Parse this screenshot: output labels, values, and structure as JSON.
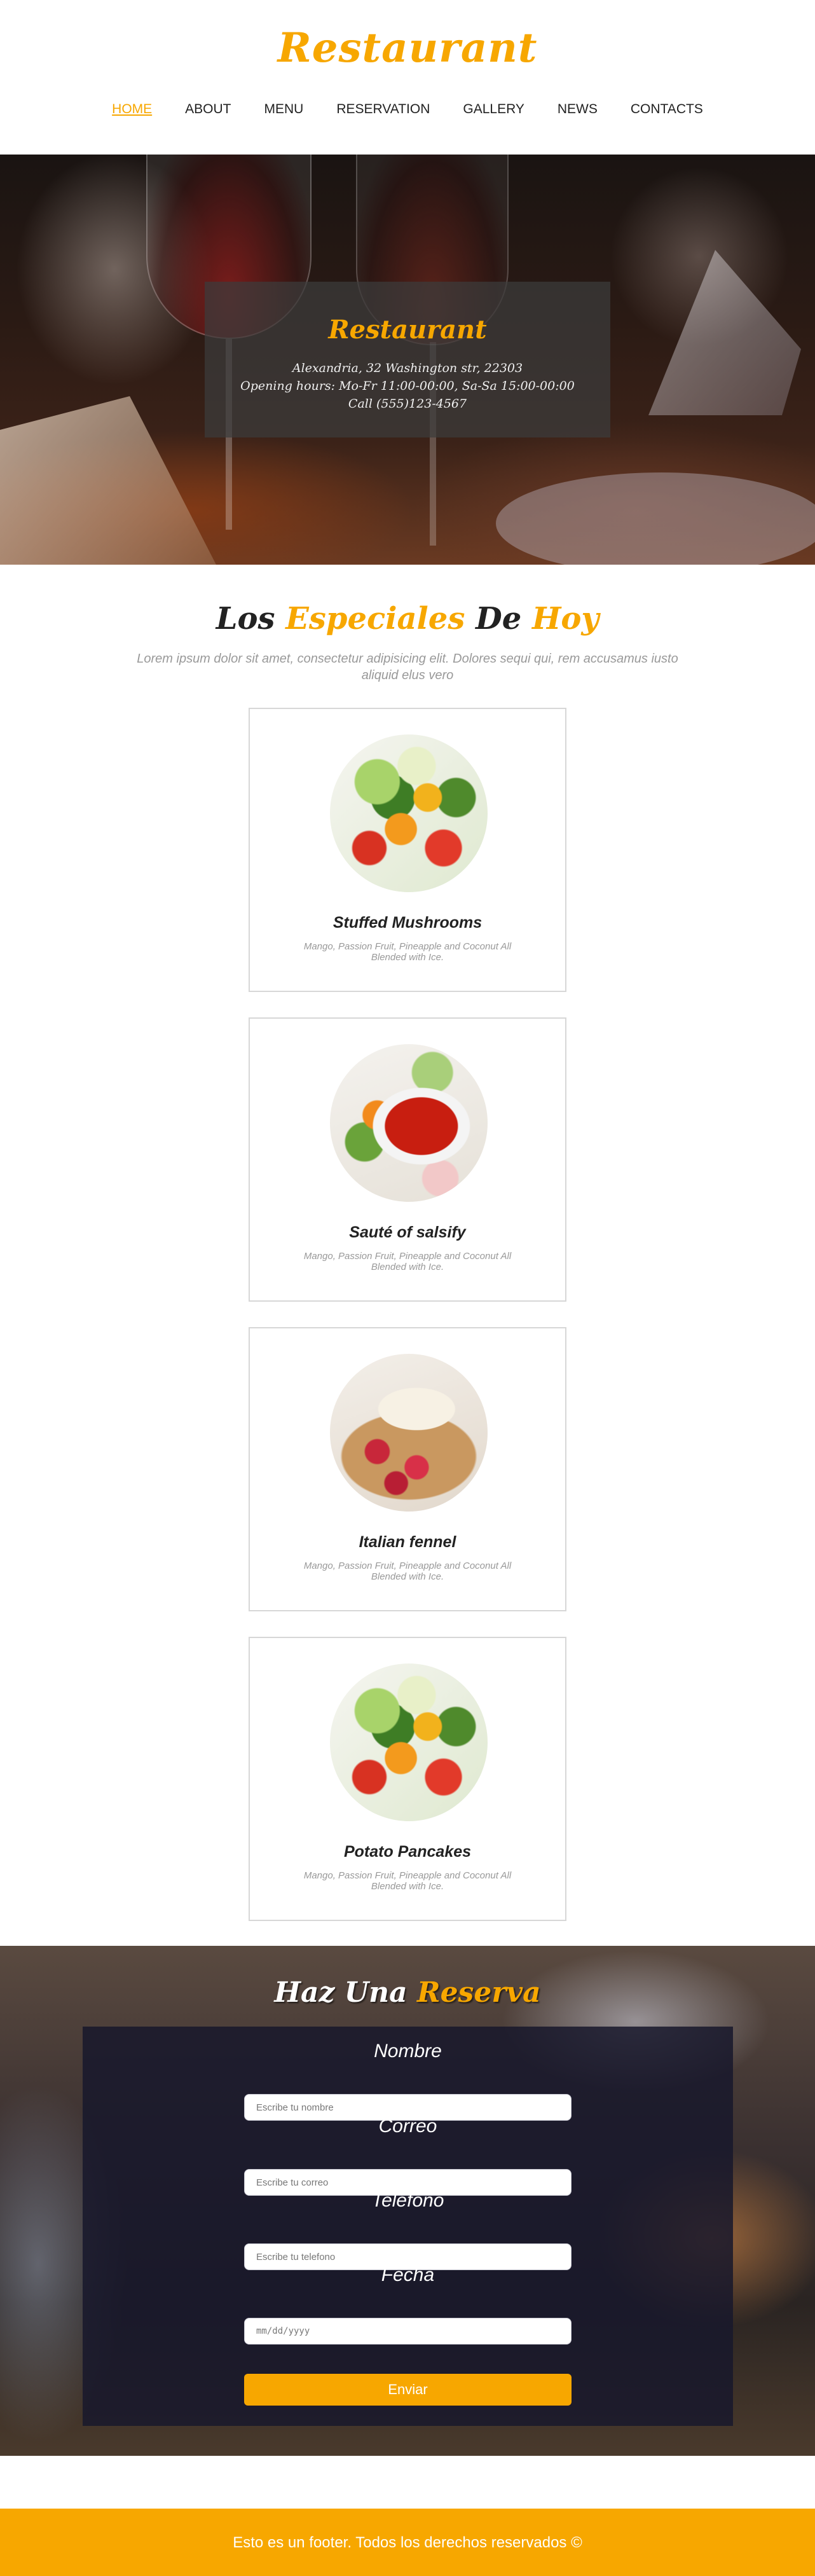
{
  "site": {
    "logo": "Restaurant"
  },
  "nav": {
    "items": [
      {
        "label": "HOME",
        "active": true
      },
      {
        "label": "ABOUT"
      },
      {
        "label": "MENU"
      },
      {
        "label": "RESERVATION"
      },
      {
        "label": "GALLERY"
      },
      {
        "label": "NEWS"
      },
      {
        "label": "CONTACTS"
      }
    ]
  },
  "hero": {
    "title": "Restaurant",
    "address": "Alexandria, 32 Washington str, 22303",
    "hours": "Opening hours: Mo-Fr 11:00-00:00, Sa-Sa 15:00-00:00",
    "phone": "Call (555)123-4567"
  },
  "specials": {
    "title_part1": "Los",
    "title_part2": "Especiales",
    "title_part3": "De",
    "title_part4": "Hoy",
    "subtitle": "Lorem ipsum dolor sit amet, consectetur adipisicing elit. Dolores sequi qui, rem accusamus iusto aliquid elus vero",
    "items": [
      {
        "name": "Stuffed Mushrooms",
        "description": "Mango, Passion Fruit, Pineapple and Coconut All Blended with Ice.",
        "image": "salad"
      },
      {
        "name": "Sauté of salsify",
        "description": "Mango, Passion Fruit, Pineapple and Coconut All Blended with Ice.",
        "image": "salsa"
      },
      {
        "name": "Italian fennel",
        "description": "Mango, Passion Fruit, Pineapple and Coconut All Blended with Ice.",
        "image": "crepe"
      },
      {
        "name": "Potato Pancakes",
        "description": "Mango, Passion Fruit, Pineapple and Coconut All Blended with Ice.",
        "image": "salad"
      }
    ]
  },
  "reservation": {
    "title_part1": "Haz",
    "title_part2": "Una",
    "title_part3": "Reserva",
    "fields": [
      {
        "label": "Nombre",
        "placeholder": "Escribe tu nombre"
      },
      {
        "label": "Correo",
        "placeholder": "Escribe tu correo"
      },
      {
        "label": "Teléfono",
        "placeholder": "Escribe tu telefono"
      },
      {
        "label": "Fecha",
        "placeholder": "mm/dd/yyyy"
      }
    ],
    "submit_label": "Enviar"
  },
  "footer": {
    "text": "Esto es un footer. Todos los derechos reservados ©"
  },
  "colors": {
    "accent": "#f7a700",
    "text": "#222222",
    "muted": "#999999"
  }
}
